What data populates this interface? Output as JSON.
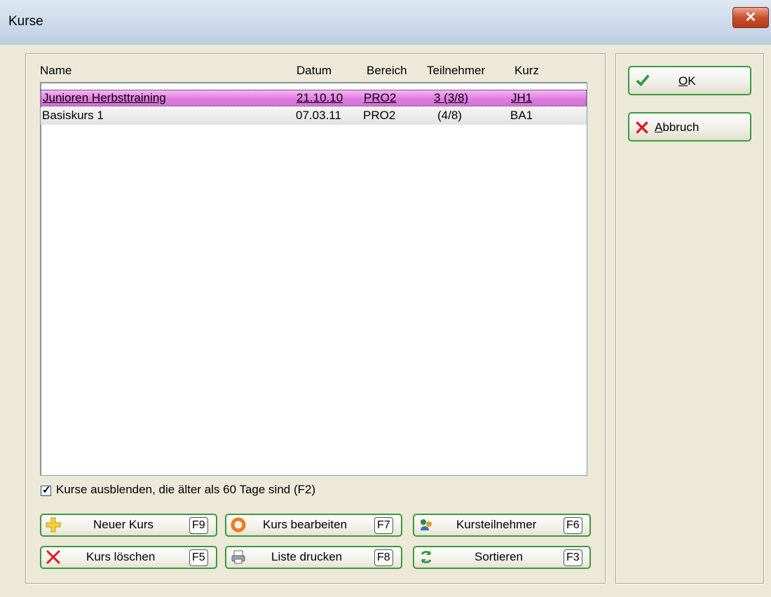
{
  "window": {
    "title": "Kurse",
    "close_glyph": "✕"
  },
  "list": {
    "columns": {
      "name": "Name",
      "datum": "Datum",
      "bereich": "Bereich",
      "teilnehmer": "Teilnehmer",
      "kurz": "Kurz"
    },
    "rows": [
      {
        "name": "Junioren Herbsttraining",
        "datum": "21.10.10",
        "bereich": "PRO2",
        "teilnehmer": "3 (3/8)",
        "kurz": "JH1",
        "selected": true
      },
      {
        "name": "Basiskurs 1",
        "datum": "07.03.11",
        "bereich": "PRO2",
        "teilnehmer": "(4/8)",
        "kurz": "BA1",
        "selected": false
      }
    ]
  },
  "filter": {
    "label": "Kurse ausblenden, die älter als 60 Tage sind (F2)",
    "checked": true
  },
  "buttons": {
    "new_course": {
      "label": "Neuer Kurs",
      "key": "F9",
      "icon": "plus-icon"
    },
    "edit_course": {
      "label": "Kurs bearbeiten",
      "key": "F7",
      "icon": "ring-icon"
    },
    "participants": {
      "label": "Kursteilnehmer",
      "key": "F6",
      "icon": "people-icon"
    },
    "delete_course": {
      "label": "Kurs löschen",
      "key": "F5",
      "icon": "cross-icon"
    },
    "print_list": {
      "label": "Liste drucken",
      "key": "F8",
      "icon": "printer-icon"
    },
    "sort": {
      "label": "Sortieren",
      "key": "F3",
      "icon": "refresh-icon"
    }
  },
  "dialog": {
    "ok": {
      "label_underlined": "O",
      "label_rest": "K",
      "icon": "check-icon"
    },
    "cancel": {
      "label_underlined": "A",
      "label_rest": "bbruch",
      "icon": "cancel-icon"
    }
  },
  "colors": {
    "button_border": "#3b9b3b",
    "selection": "#e07de0",
    "title_bar": "#c7d6e8"
  }
}
